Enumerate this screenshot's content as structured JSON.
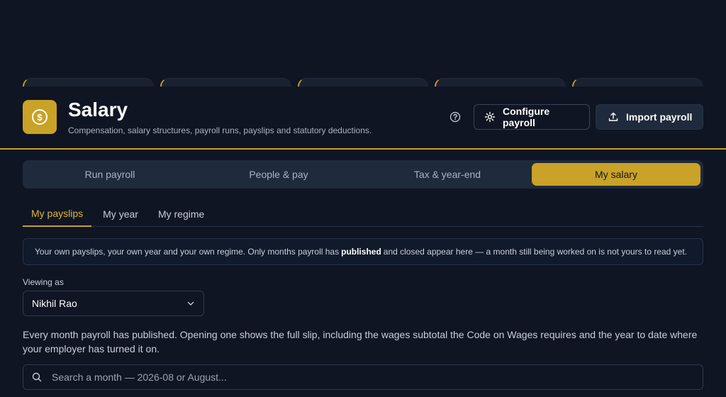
{
  "header": {
    "title": "Salary",
    "subtitle": "Compensation, salary structures, payroll runs, payslips and statutory deductions.",
    "app_icon": "dollar-coin-icon",
    "help_icon": "help-circle-icon",
    "configure_label": "Configure payroll",
    "import_label": "Import payroll"
  },
  "segments": [
    {
      "label": "Run payroll",
      "active": false
    },
    {
      "label": "People & pay",
      "active": false
    },
    {
      "label": "Tax & year-end",
      "active": false
    },
    {
      "label": "My salary",
      "active": true
    }
  ],
  "subtabs": [
    {
      "label": "My payslips",
      "active": true
    },
    {
      "label": "My year",
      "active": false
    },
    {
      "label": "My regime",
      "active": false
    }
  ],
  "notice": {
    "before": "Your own payslips, your own year and your own regime. Only months payroll has",
    "bold": "published",
    "after": "and closed appear here — a month still being worked on is not yours to read yet."
  },
  "viewing": {
    "label": "Viewing as",
    "selected": "Nikhil Rao"
  },
  "description": "Every month payroll has published. Opening one shows the full slip, including the wages subtotal the Code on Wages requires and the year to date where your employer has turned it on.",
  "search": {
    "placeholder": "Search a month — 2026-08 or August..."
  },
  "colors": {
    "accent": "#c9a227",
    "background": "#0f1523",
    "surface": "#1f2a3c"
  }
}
